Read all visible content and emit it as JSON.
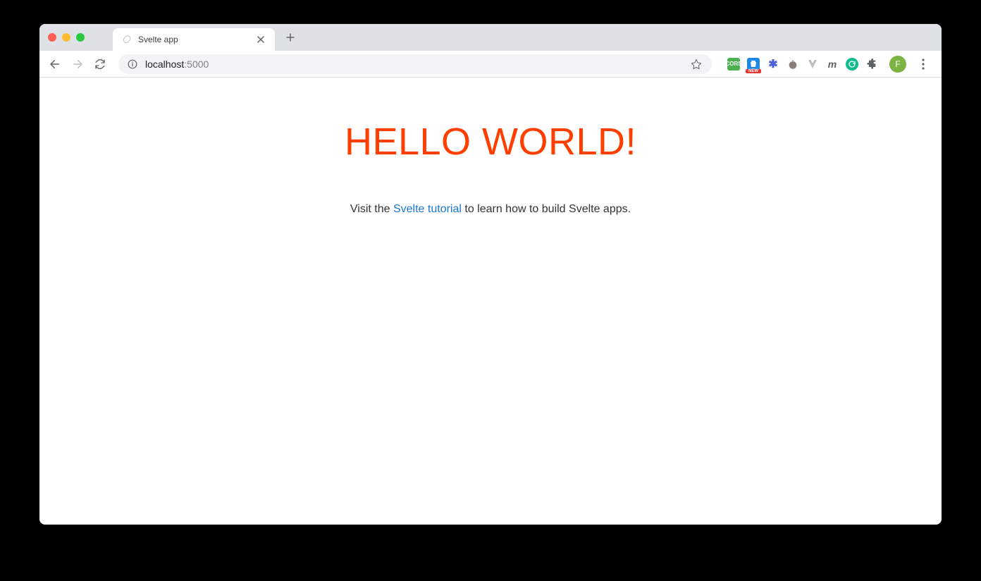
{
  "browser": {
    "tab": {
      "title": "Svelte app"
    },
    "address": {
      "host": "localhost",
      "port": ":5000"
    },
    "extensions": {
      "cors_label": "CORS",
      "shop_badge": "NEW",
      "avatar_initial": "F"
    }
  },
  "page": {
    "heading": "HELLO WORLD!",
    "intro_prefix": "Visit the ",
    "intro_link": "Svelte tutorial",
    "intro_suffix": " to learn how to build Svelte apps."
  }
}
